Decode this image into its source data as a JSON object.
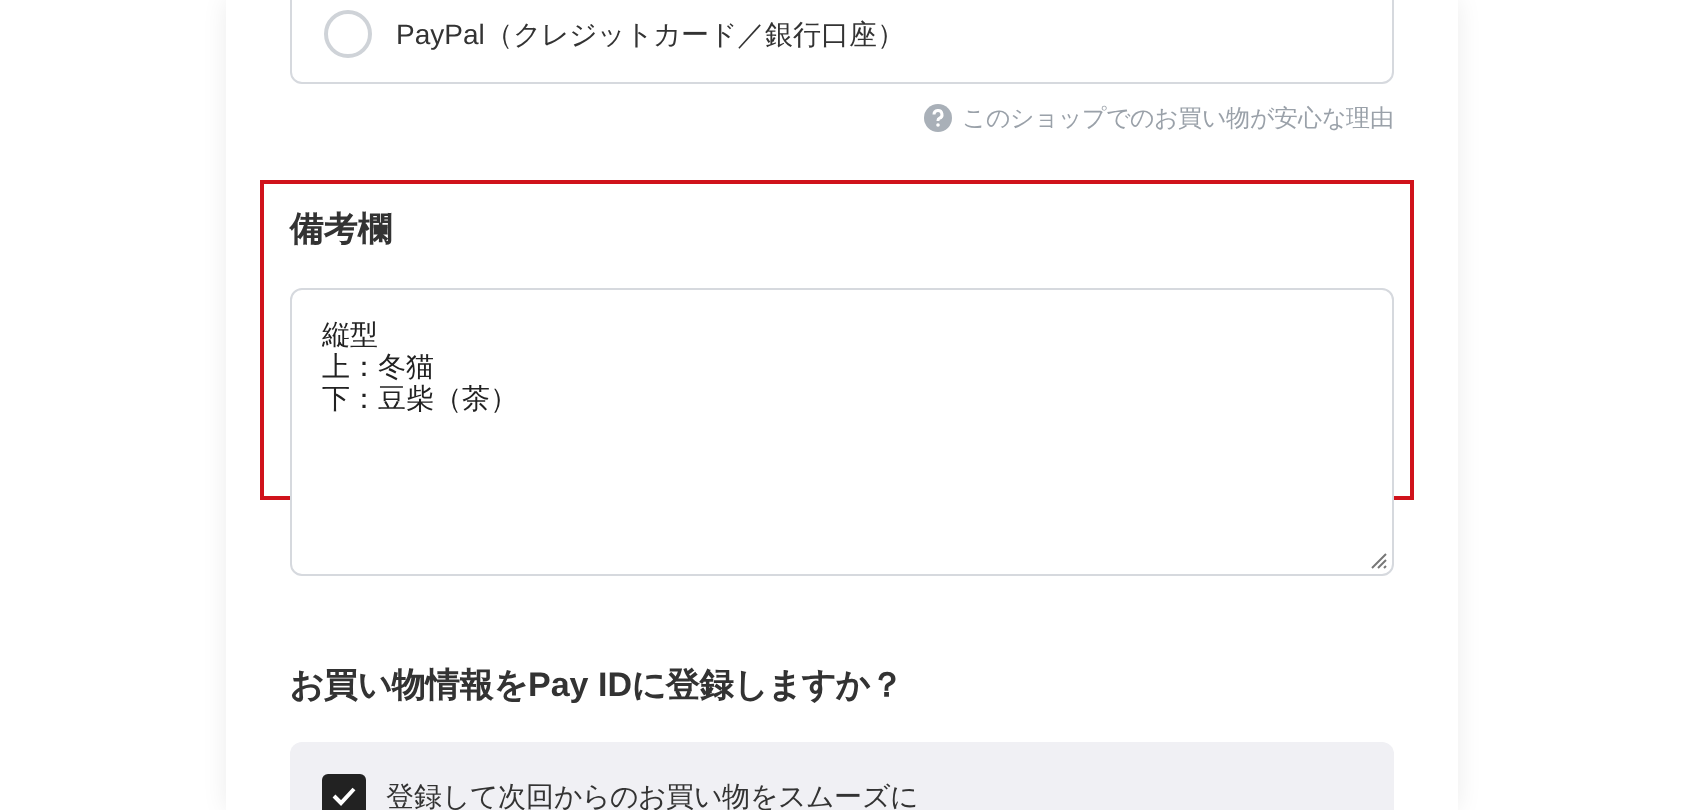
{
  "payment_options": [
    {
      "label": "PayPal（クレジットカード／銀行口座）",
      "selected": false
    }
  ],
  "help_link": "このショップでのお買い物が安心な理由",
  "notes": {
    "heading": "備考欄",
    "lines": [
      "縦型",
      "上：冬猫",
      "下：豆柴（茶）"
    ],
    "highlighted": true
  },
  "register": {
    "heading": "お買い物情報をPay IDに登録しますか？",
    "option": {
      "label": "登録して次回からのお買い物をスムーズに",
      "checked": true
    }
  }
}
